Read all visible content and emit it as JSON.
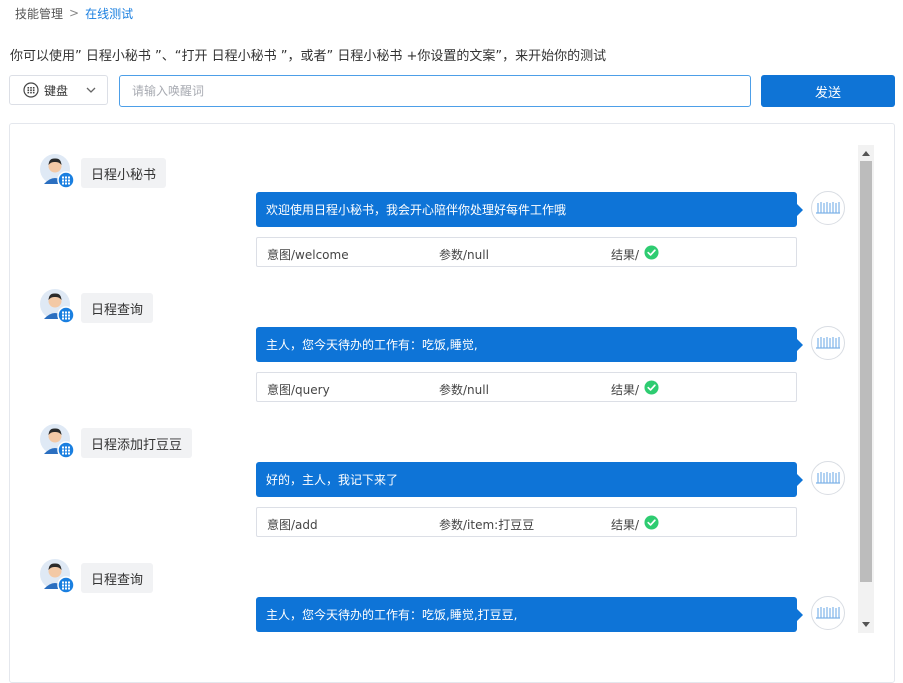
{
  "breadcrumb": {
    "parent": "技能管理",
    "separator": ">",
    "current": "在线测试"
  },
  "instruction": "你可以使用” 日程小秘书 ”、“打开 日程小秘书 ”，或者” 日程小秘书 +你设置的文案”，来开始你的测试",
  "input_mode": {
    "label": "键盘",
    "icon": "keyboard-icon"
  },
  "wake_input": {
    "value": "",
    "placeholder": "请输入唤醒词"
  },
  "send_button": "发送",
  "colors": {
    "accent": "#0e74d7",
    "link": "#1a7fe0",
    "success": "#2ecc71"
  },
  "conversation": [
    {
      "user": "日程小秘书",
      "bot": "欢迎使用日程小秘书，我会开心陪伴你处理好每件工作哦",
      "result": {
        "intent": "意图/welcome",
        "params": "参数/null",
        "outcome": "结果/"
      }
    },
    {
      "user": "日程查询",
      "bot": "主人，您今天待办的工作有：吃饭,睡觉,",
      "result": {
        "intent": "意图/query",
        "params": "参数/null",
        "outcome": "结果/"
      }
    },
    {
      "user": "日程添加打豆豆",
      "bot": "好的，主人，我记下来了",
      "result": {
        "intent": "意图/add",
        "params": "参数/item:打豆豆",
        "outcome": "结果/"
      }
    },
    {
      "user": "日程查询",
      "bot": "主人，您今天待办的工作有：吃饭,睡觉,打豆豆,"
    }
  ]
}
